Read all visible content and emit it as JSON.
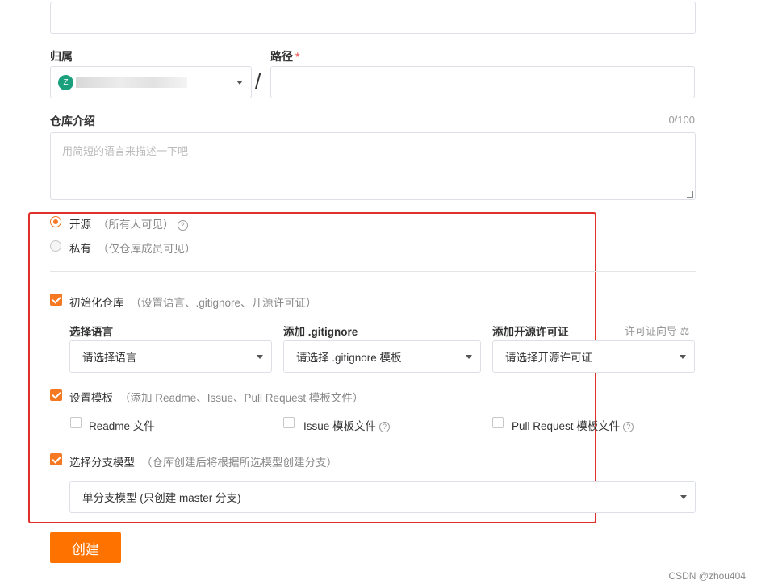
{
  "top_input": {
    "value": ""
  },
  "owner": {
    "label": "归属",
    "avatar_letter": "Z",
    "value_masked": "",
    "separator": "/"
  },
  "path": {
    "label": "路径",
    "required_mark": "*",
    "value": ""
  },
  "description": {
    "label": "仓库介绍",
    "counter": "0/100",
    "placeholder": "用简短的语言来描述一下吧"
  },
  "visibility": {
    "options": [
      {
        "label": "开源",
        "hint": "（所有人可见）",
        "selected": true
      },
      {
        "label": "私有",
        "hint": "（仅仓库成员可见）",
        "selected": false
      }
    ],
    "help_glyph": "?"
  },
  "init_repo": {
    "label": "初始化仓库",
    "hint": "（设置语言、.gitignore、开源许可证）",
    "checked": true,
    "language": {
      "label": "选择语言",
      "placeholder": "请选择语言"
    },
    "gitignore": {
      "label": "添加 .gitignore",
      "placeholder": "请选择 .gitignore 模板"
    },
    "license": {
      "label": "添加开源许可证",
      "placeholder": "请选择开源许可证",
      "guide_link": "许可证向导",
      "guide_icon": "⚖"
    }
  },
  "templates": {
    "label": "设置模板",
    "hint": "（添加 Readme、Issue、Pull Request 模板文件）",
    "checked": true,
    "items": [
      {
        "label": "Readme 文件",
        "checked": false,
        "help": false
      },
      {
        "label": "Issue 模板文件",
        "checked": false,
        "help": true
      },
      {
        "label": "Pull Request 模板文件",
        "checked": false,
        "help": true
      }
    ]
  },
  "branch_model": {
    "label": "选择分支模型",
    "hint": "（仓库创建后将根据所选模型创建分支）",
    "checked": true,
    "selected": "单分支模型 (只创建 master 分支)"
  },
  "create_button": {
    "label": "创建"
  },
  "watermark": "CSDN @zhou404",
  "colors": {
    "accent": "#fe7300",
    "highlight_frame": "#e0302a"
  }
}
